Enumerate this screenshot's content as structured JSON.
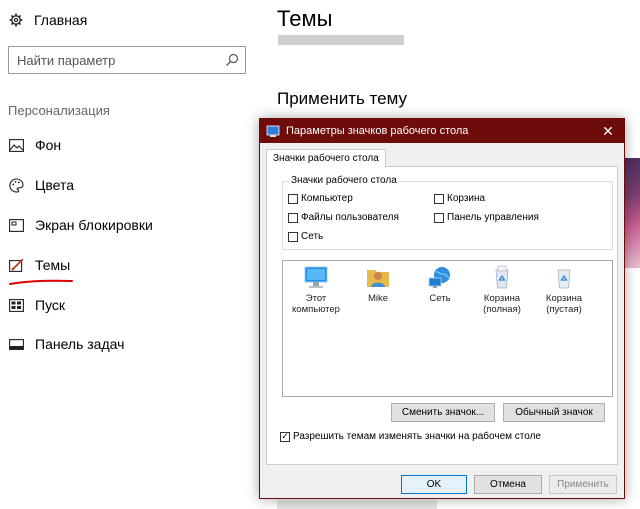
{
  "sidebar": {
    "home_label": "Главная",
    "search_placeholder": "Найти параметр",
    "section_title": "Персонализация",
    "items": [
      {
        "label": "Фон"
      },
      {
        "label": "Цвета"
      },
      {
        "label": "Экран блокировки"
      },
      {
        "label": "Темы"
      },
      {
        "label": "Пуск"
      },
      {
        "label": "Панель задач"
      }
    ]
  },
  "main": {
    "title": "Темы",
    "apply_heading": "Применить тему"
  },
  "dialog": {
    "title": "Параметры значков рабочего стола",
    "tab": "Значки рабочего стола",
    "group_legend": "Значки рабочего стола",
    "checkboxes": [
      {
        "label": "Компьютер",
        "checked": false
      },
      {
        "label": "Корзина",
        "checked": false
      },
      {
        "label": "Файлы пользователя",
        "checked": false
      },
      {
        "label": "Панель управления",
        "checked": false
      },
      {
        "label": "Сеть",
        "checked": false
      }
    ],
    "icons": [
      {
        "label": "Этот компьютер",
        "icon": "monitor-icon"
      },
      {
        "label": "Mike",
        "icon": "user-folder-icon"
      },
      {
        "label": "Сеть",
        "icon": "network-icon"
      },
      {
        "label": "Корзина (полная)",
        "icon": "recycle-bin-full-icon"
      },
      {
        "label": "Корзина (пустая)",
        "icon": "recycle-bin-empty-icon"
      }
    ],
    "change_icon_button": "Сменить значок...",
    "default_icon_button": "Обычный значок",
    "allow_themes_label": "Разрешить темам изменять значки на рабочем столе",
    "allow_themes_checked": true,
    "ok_button": "OK",
    "cancel_button": "Отмена",
    "apply_button": "Применить"
  },
  "colors": {
    "dialog_title_bar": "#6e0b0b",
    "annotation_underline": "#e00000"
  }
}
